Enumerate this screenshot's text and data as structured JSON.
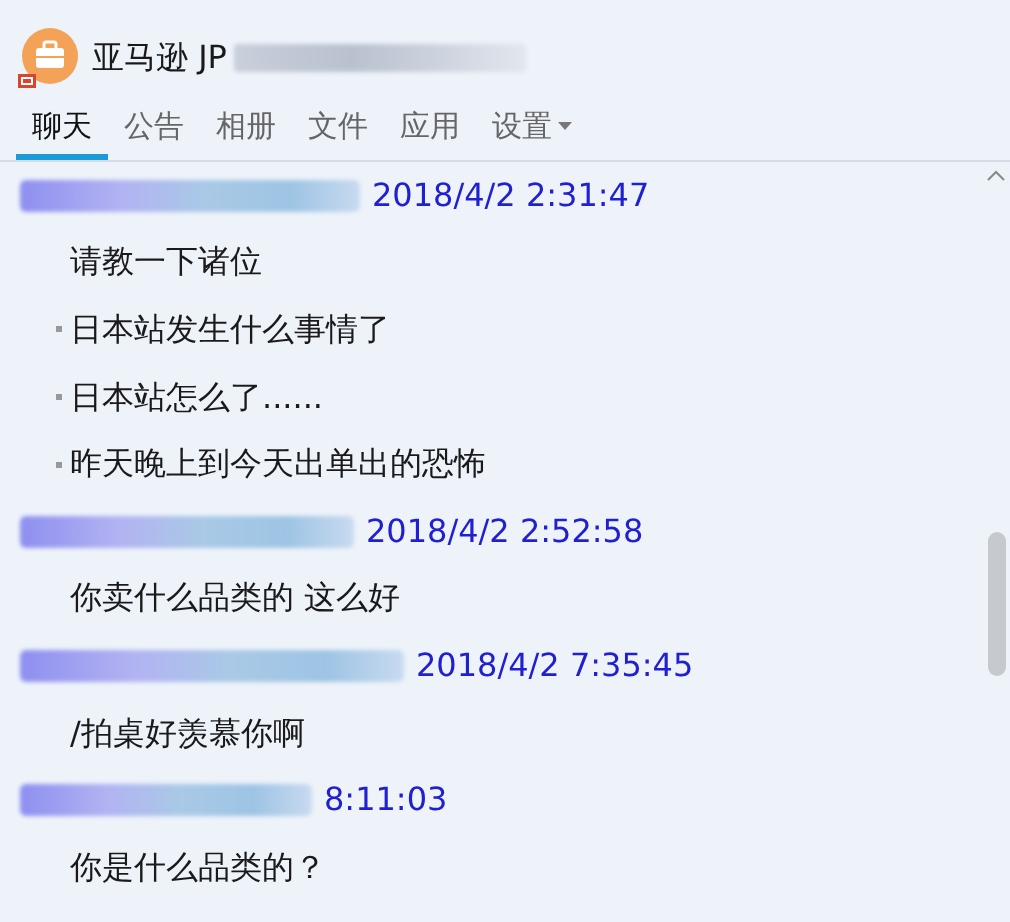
{
  "header": {
    "title": "亚马逊 JP"
  },
  "tabs": [
    {
      "label": "聊天",
      "selected": true,
      "dropdown": false
    },
    {
      "label": "公告",
      "selected": false,
      "dropdown": false
    },
    {
      "label": "相册",
      "selected": false,
      "dropdown": false
    },
    {
      "label": "文件",
      "selected": false,
      "dropdown": false
    },
    {
      "label": "应用",
      "selected": false,
      "dropdown": false
    },
    {
      "label": "设置",
      "selected": false,
      "dropdown": true
    }
  ],
  "messages": [
    {
      "time": "2018/4/2 2:31:47",
      "lines": [
        "请教一下诸位",
        "日本站发生什么事情了",
        "日本站怎么了......",
        "昨天晚上到今天出单出的恐怖"
      ]
    },
    {
      "time": "2018/4/2 2:52:58",
      "lines": [
        "你卖什么品类的 这么好"
      ]
    },
    {
      "time": "2018/4/2 7:35:45",
      "lines": [
        "/拍桌好羡慕你啊"
      ]
    },
    {
      "time": "8:11:03",
      "lines": [
        "你是什么品类的？"
      ]
    }
  ]
}
